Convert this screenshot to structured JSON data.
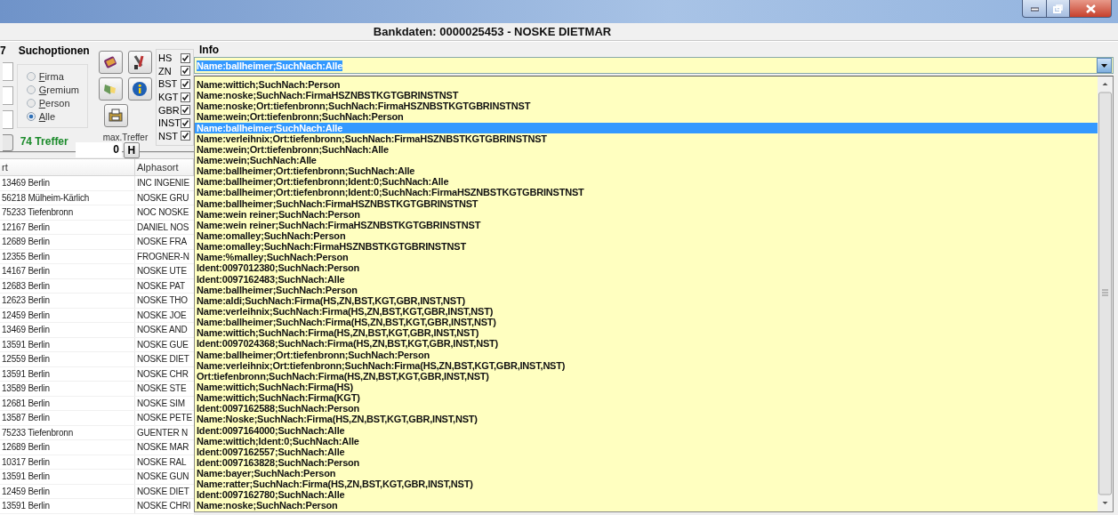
{
  "window": {
    "title": "Bankdaten: 0000025453 - NOSKE DIETMAR"
  },
  "search": {
    "cut_label": "7",
    "group_title": "Suchoptionen",
    "options": [
      {
        "label": "Firma",
        "selected": false
      },
      {
        "label": "Gremium",
        "selected": false
      },
      {
        "label": "Person",
        "selected": false
      },
      {
        "label": "Alle",
        "selected": true
      }
    ],
    "hits": "74 Treffer",
    "max_hits_label": "max.Treffer",
    "max_hits_value": "0",
    "h_button": "H",
    "types": [
      {
        "label": "HS",
        "checked": true
      },
      {
        "label": "ZN",
        "checked": true
      },
      {
        "label": "BST",
        "checked": true
      },
      {
        "label": "KGT",
        "checked": true
      },
      {
        "label": "GBR",
        "checked": true
      },
      {
        "label": "INST",
        "checked": true
      },
      {
        "label": "NST",
        "checked": true
      }
    ]
  },
  "table": {
    "columns": [
      "rt",
      "Alphasort"
    ],
    "rows": [
      [
        "13469 Berlin",
        "INC INGENIE"
      ],
      [
        "56218 Mülheim-Kärlich",
        "NOSKE GRU"
      ],
      [
        "75233 Tiefenbronn",
        "NOC NOSKE"
      ],
      [
        "12167 Berlin",
        "DANIEL NOS"
      ],
      [
        "12689 Berlin",
        "NOSKE FRA"
      ],
      [
        "12355 Berlin",
        "FROGNER-N"
      ],
      [
        "14167 Berlin",
        "NOSKE UTE"
      ],
      [
        "12683 Berlin",
        "NOSKE PAT"
      ],
      [
        "12623 Berlin",
        "NOSKE THO"
      ],
      [
        "12459 Berlin",
        "NOSKE JOE"
      ],
      [
        "13469 Berlin",
        "NOSKE AND"
      ],
      [
        "13591 Berlin",
        "NOSKE GUE"
      ],
      [
        "12559 Berlin",
        "NOSKE DIET"
      ],
      [
        "13591 Berlin",
        "NOSKE CHR"
      ],
      [
        "13589 Berlin",
        "NOSKE STE"
      ],
      [
        "12681 Berlin",
        "NOSKE SIM"
      ],
      [
        "13587 Berlin",
        "NOSKE PETE"
      ],
      [
        "75233 Tiefenbronn",
        "GUENTER N"
      ],
      [
        "12689 Berlin",
        "NOSKE MAR"
      ],
      [
        "10317 Berlin",
        "NOSKE RAL"
      ],
      [
        "13591 Berlin",
        "NOSKE GUN"
      ],
      [
        "12459 Berlin",
        "NOSKE DIET"
      ],
      [
        "13591 Berlin",
        "NOSKE CHRI"
      ]
    ]
  },
  "info": {
    "label": "Info",
    "value": "Name:ballheimer;SuchNach:Alle",
    "items": [
      {
        "text": "Name:wittich;SuchNach:Person",
        "selected": false
      },
      {
        "text": "Name:noske;SuchNach:FirmaHSZNBSTKGTGBRINSTNST",
        "selected": false
      },
      {
        "text": "Name:noske;Ort:tiefenbronn;SuchNach:FirmaHSZNBSTKGTGBRINSTNST",
        "selected": false
      },
      {
        "text": "Name:wein;Ort:tiefenbronn;SuchNach:Person",
        "selected": false
      },
      {
        "text": "Name:ballheimer;SuchNach:Alle",
        "selected": true
      },
      {
        "text": "Name:verleihnix;Ort:tiefenbronn;SuchNach:FirmaHSZNBSTKGTGBRINSTNST",
        "selected": false
      },
      {
        "text": "Name:wein;Ort:tiefenbronn;SuchNach:Alle",
        "selected": false
      },
      {
        "text": "Name:wein;SuchNach:Alle",
        "selected": false
      },
      {
        "text": "Name:ballheimer;Ort:tiefenbronn;SuchNach:Alle",
        "selected": false
      },
      {
        "text": "Name:ballheimer;Ort:tiefenbronn;Ident:0;SuchNach:Alle",
        "selected": false
      },
      {
        "text": "Name:ballheimer;Ort:tiefenbronn;Ident:0;SuchNach:FirmaHSZNBSTKGTGBRINSTNST",
        "selected": false
      },
      {
        "text": "Name:ballheimer;SuchNach:FirmaHSZNBSTKGTGBRINSTNST",
        "selected": false
      },
      {
        "text": "Name:wein reiner;SuchNach:Person",
        "selected": false
      },
      {
        "text": "Name:wein reiner;SuchNach:FirmaHSZNBSTKGTGBRINSTNST",
        "selected": false
      },
      {
        "text": "Name:omalley;SuchNach:Person",
        "selected": false
      },
      {
        "text": "Name:omalley;SuchNach:FirmaHSZNBSTKGTGBRINSTNST",
        "selected": false
      },
      {
        "text": "Name:%malley;SuchNach:Person",
        "selected": false
      },
      {
        "text": "Ident:0097012380;SuchNach:Person",
        "selected": false
      },
      {
        "text": "Ident:0097162483;SuchNach:Alle",
        "selected": false
      },
      {
        "text": "Name:ballheimer;SuchNach:Person",
        "selected": false
      },
      {
        "text": "Name:aldi;SuchNach:Firma(HS,ZN,BST,KGT,GBR,INST,NST)",
        "selected": false
      },
      {
        "text": "Name:verleihnix;SuchNach:Firma(HS,ZN,BST,KGT,GBR,INST,NST)",
        "selected": false
      },
      {
        "text": "Name:ballheimer;SuchNach:Firma(HS,ZN,BST,KGT,GBR,INST,NST)",
        "selected": false
      },
      {
        "text": "Name:wittich;SuchNach:Firma(HS,ZN,BST,KGT,GBR,INST,NST)",
        "selected": false
      },
      {
        "text": "Ident:0097024368;SuchNach:Firma(HS,ZN,BST,KGT,GBR,INST,NST)",
        "selected": false
      },
      {
        "text": "Name:ballheimer;Ort:tiefenbronn;SuchNach:Person",
        "selected": false
      },
      {
        "text": "Name:verleihnix;Ort:tiefenbronn;SuchNach:Firma(HS,ZN,BST,KGT,GBR,INST,NST)",
        "selected": false
      },
      {
        "text": "Ort:tiefenbronn;SuchNach:Firma(HS,ZN,BST,KGT,GBR,INST,NST)",
        "selected": false
      },
      {
        "text": "Name:wittich;SuchNach:Firma(HS)",
        "selected": false
      },
      {
        "text": "Name:wittich;SuchNach:Firma(KGT)",
        "selected": false
      },
      {
        "text": "Ident:0097162588;SuchNach:Person",
        "selected": false
      },
      {
        "text": "Name:Noske;SuchNach:Firma(HS,ZN,BST,KGT,GBR,INST,NST)",
        "selected": false
      },
      {
        "text": "Ident:0097164000;SuchNach:Alle",
        "selected": false
      },
      {
        "text": "Name:wittich;Ident:0;SuchNach:Alle",
        "selected": false
      },
      {
        "text": "Ident:0097162557;SuchNach:Alle",
        "selected": false
      },
      {
        "text": "Ident:0097163828;SuchNach:Person",
        "selected": false
      },
      {
        "text": "Name:bayer;SuchNach:Person",
        "selected": false
      },
      {
        "text": "Name:ratter;SuchNach:Firma(HS,ZN,BST,KGT,GBR,INST,NST)",
        "selected": false
      },
      {
        "text": "Ident:0097162780;SuchNach:Alle",
        "selected": false
      },
      {
        "text": "Name:noske;SuchNach:Person",
        "selected": false
      }
    ]
  }
}
